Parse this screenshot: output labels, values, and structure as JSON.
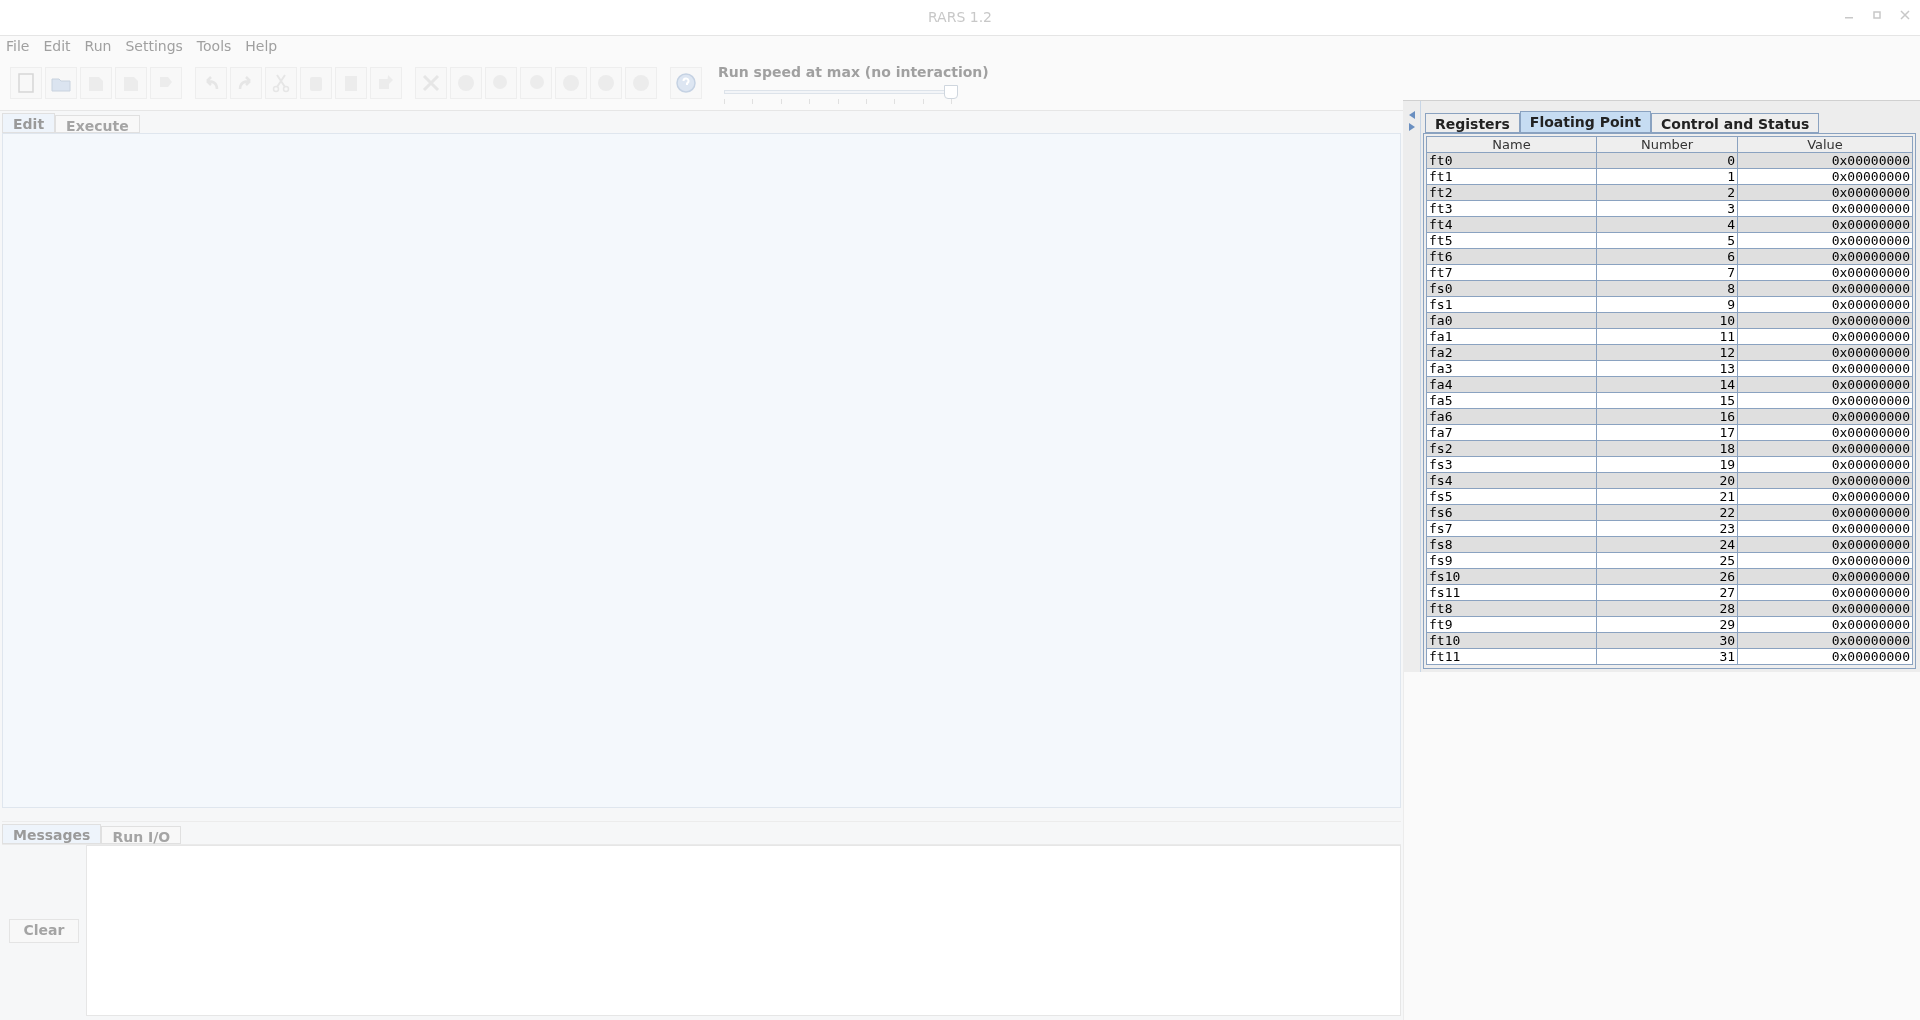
{
  "window": {
    "title": "RARS 1.2"
  },
  "menu": [
    "File",
    "Edit",
    "Run",
    "Settings",
    "Tools",
    "Help"
  ],
  "run_speed": {
    "label": "Run speed at max (no interaction)",
    "level": 1
  },
  "editor_tabs": [
    {
      "label": "Edit",
      "selected": true
    },
    {
      "label": "Execute",
      "selected": false
    }
  ],
  "message_tabs": [
    {
      "label": "Messages",
      "selected": true
    },
    {
      "label": "Run I/O",
      "selected": false
    }
  ],
  "clear_button": "Clear",
  "register_tabs": [
    {
      "label": "Registers",
      "selected": false
    },
    {
      "label": "Floating Point",
      "selected": true
    },
    {
      "label": "Control and Status",
      "selected": false
    }
  ],
  "table": {
    "columns": [
      "Name",
      "Number",
      "Value"
    ],
    "rows": [
      [
        "ft0",
        "0",
        "0x00000000"
      ],
      [
        "ft1",
        "1",
        "0x00000000"
      ],
      [
        "ft2",
        "2",
        "0x00000000"
      ],
      [
        "ft3",
        "3",
        "0x00000000"
      ],
      [
        "ft4",
        "4",
        "0x00000000"
      ],
      [
        "ft5",
        "5",
        "0x00000000"
      ],
      [
        "ft6",
        "6",
        "0x00000000"
      ],
      [
        "ft7",
        "7",
        "0x00000000"
      ],
      [
        "fs0",
        "8",
        "0x00000000"
      ],
      [
        "fs1",
        "9",
        "0x00000000"
      ],
      [
        "fa0",
        "10",
        "0x00000000"
      ],
      [
        "fa1",
        "11",
        "0x00000000"
      ],
      [
        "fa2",
        "12",
        "0x00000000"
      ],
      [
        "fa3",
        "13",
        "0x00000000"
      ],
      [
        "fa4",
        "14",
        "0x00000000"
      ],
      [
        "fa5",
        "15",
        "0x00000000"
      ],
      [
        "fa6",
        "16",
        "0x00000000"
      ],
      [
        "fa7",
        "17",
        "0x00000000"
      ],
      [
        "fs2",
        "18",
        "0x00000000"
      ],
      [
        "fs3",
        "19",
        "0x00000000"
      ],
      [
        "fs4",
        "20",
        "0x00000000"
      ],
      [
        "fs5",
        "21",
        "0x00000000"
      ],
      [
        "fs6",
        "22",
        "0x00000000"
      ],
      [
        "fs7",
        "23",
        "0x00000000"
      ],
      [
        "fs8",
        "24",
        "0x00000000"
      ],
      [
        "fs9",
        "25",
        "0x00000000"
      ],
      [
        "fs10",
        "26",
        "0x00000000"
      ],
      [
        "fs11",
        "27",
        "0x00000000"
      ],
      [
        "ft8",
        "28",
        "0x00000000"
      ],
      [
        "ft9",
        "29",
        "0x00000000"
      ],
      [
        "ft10",
        "30",
        "0x00000000"
      ],
      [
        "ft11",
        "31",
        "0x00000000"
      ]
    ]
  }
}
